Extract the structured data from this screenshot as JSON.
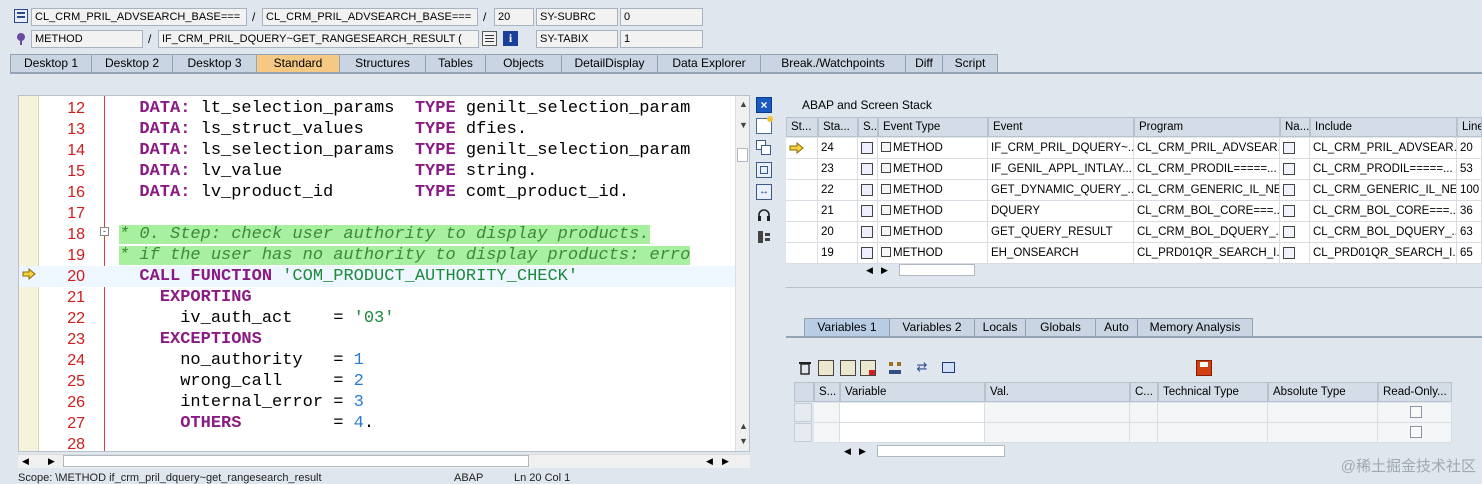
{
  "header": {
    "row1": {
      "field1": "CL_CRM_PRIL_ADVSEARCH_BASE===",
      "field2": "CL_CRM_PRIL_ADVSEARCH_BASE===",
      "line": "20",
      "sysvar": "SY-SUBRC",
      "sysval": "0"
    },
    "row2": {
      "type": "METHOD",
      "name": "IF_CRM_PRIL_DQUERY~GET_RANGESEARCH_RESULT (",
      "sysvar": "SY-TABIX",
      "sysval": "1"
    }
  },
  "tabs": [
    {
      "label": "Desktop 1",
      "active": false
    },
    {
      "label": "Desktop 2",
      "active": false
    },
    {
      "label": "Desktop 3",
      "active": false
    },
    {
      "label": "Standard",
      "active": true
    },
    {
      "label": "Structures",
      "active": false
    },
    {
      "label": "Tables",
      "active": false
    },
    {
      "label": "Objects",
      "active": false
    },
    {
      "label": "DetailDisplay",
      "active": false
    },
    {
      "label": "Data Explorer",
      "active": false
    },
    {
      "label": "Break./Watchpoints",
      "active": false
    },
    {
      "label": "Diff",
      "active": false
    },
    {
      "label": "Script",
      "active": false
    }
  ],
  "code": [
    {
      "n": "12",
      "html": "  <span class=\"kw\">DATA:</span> lt_selection_params  <span class=\"kw\">TYPE</span> genilt_selection_param"
    },
    {
      "n": "13",
      "html": "  <span class=\"kw\">DATA:</span> ls_struct_values     <span class=\"kw\">TYPE</span> dfies."
    },
    {
      "n": "14",
      "html": "  <span class=\"kw\">DATA:</span> ls_selection_params  <span class=\"kw\">TYPE</span> genilt_selection_param"
    },
    {
      "n": "15",
      "html": "  <span class=\"kw\">DATA:</span> lv_value             <span class=\"kw\">TYPE</span> string."
    },
    {
      "n": "16",
      "html": "  <span class=\"kw\">DATA:</span> lv_product_id        <span class=\"kw\">TYPE</span> comt_product_id."
    },
    {
      "n": "17",
      "html": ""
    },
    {
      "n": "18",
      "html": "<span class=\"cmt green\">* 0. Step: check user authority to display products.</span>"
    },
    {
      "n": "19",
      "html": "<span class=\"cmt green\">* if the user has no authority to display products: erro</span>"
    },
    {
      "n": "20",
      "html": "  <span class=\"kw\">CALL FUNCTION</span> <span class=\"str\">'COM_PRODUCT_AUTHORITY_CHECK'</span>"
    },
    {
      "n": "21",
      "html": "    <span class=\"kw\">EXPORTING</span>"
    },
    {
      "n": "22",
      "html": "      iv_auth_act    = <span class=\"str\">'03'</span>"
    },
    {
      "n": "23",
      "html": "    <span class=\"kw\">EXCEPTIONS</span>"
    },
    {
      "n": "24",
      "html": "      no_authority   = <span class=\"num\">1</span>"
    },
    {
      "n": "25",
      "html": "      wrong_call     = <span class=\"num\">2</span>"
    },
    {
      "n": "26",
      "html": "      internal_error = <span class=\"num\">3</span>"
    },
    {
      "n": "27",
      "html": "      <span class=\"kw\">OTHERS</span>         = <span class=\"num\">4</span>."
    },
    {
      "n": "28",
      "html": ""
    }
  ],
  "status_bar": {
    "scope": "Scope: \\METHOD if_crm_pril_dquery~get_rangesearch_result",
    "lang": "ABAP",
    "pos": "Ln 20 Col 1"
  },
  "stack": {
    "title": "ABAP and Screen Stack",
    "columns": [
      "St...",
      "Sta...",
      "S...",
      "Event Type",
      "Event",
      "Program",
      "Na...",
      "Include",
      "Line"
    ],
    "rows": [
      {
        "current": true,
        "level": "24",
        "type": "METHOD",
        "event": "IF_CRM_PRIL_DQUERY~...",
        "program": "CL_CRM_PRIL_ADVSEAR...",
        "include": "CL_CRM_PRIL_ADVSEAR...",
        "line": "20"
      },
      {
        "current": false,
        "level": "23",
        "type": "METHOD",
        "event": "IF_GENIL_APPL_INTLAY...",
        "program": "CL_CRM_PRODIL=====...",
        "include": "CL_CRM_PRODIL=====...",
        "line": "53"
      },
      {
        "current": false,
        "level": "22",
        "type": "METHOD",
        "event": "GET_DYNAMIC_QUERY_...",
        "program": "CL_CRM_GENERIC_IL_NE...",
        "include": "CL_CRM_GENERIC_IL_NE...",
        "line": "100"
      },
      {
        "current": false,
        "level": "21",
        "type": "METHOD",
        "event": "DQUERY",
        "program": "CL_CRM_BOL_CORE===...",
        "include": "CL_CRM_BOL_CORE===...",
        "line": "36"
      },
      {
        "current": false,
        "level": "20",
        "type": "METHOD",
        "event": "GET_QUERY_RESULT",
        "program": "CL_CRM_BOL_DQUERY_...",
        "include": "CL_CRM_BOL_DQUERY_...",
        "line": "63"
      },
      {
        "current": false,
        "level": "19",
        "type": "METHOD",
        "event": "EH_ONSEARCH",
        "program": "CL_PRD01QR_SEARCH_I...",
        "include": "CL_PRD01QR_SEARCH_I...",
        "line": "65"
      }
    ]
  },
  "var_tabs": [
    {
      "label": "Variables 1",
      "active": true
    },
    {
      "label": "Variables 2",
      "active": false
    },
    {
      "label": "Locals",
      "active": false
    },
    {
      "label": "Globals",
      "active": false
    },
    {
      "label": "Auto",
      "active": false
    },
    {
      "label": "Memory Analysis",
      "active": false
    }
  ],
  "vars": {
    "columns": [
      "S...",
      "Variable",
      "Val.",
      "C...",
      "Technical Type",
      "Absolute Type",
      "Read-Only..."
    ]
  },
  "watermark": "@稀土掘金技术社区",
  "colors": {
    "accent_tab": "#f5c983",
    "comment_bg": "#a8f0a0",
    "line_number": "#d01c1c",
    "keyword": "#8a1a84"
  }
}
